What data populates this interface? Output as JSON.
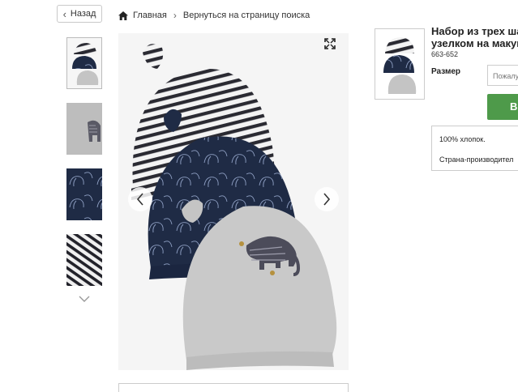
{
  "nav": {
    "back_label": "Назад"
  },
  "breadcrumb": {
    "home_label": "Главная",
    "search_label": "Вернуться на страницу поиска"
  },
  "product": {
    "title_line1": "Набор из трех шап",
    "title_line2": "узелком на макуш",
    "sku": "663-652",
    "size_label": "Размер",
    "size_placeholder": "Пожалу",
    "buy_label": "В",
    "composition": "100% хлопок.",
    "country": "Страна-производител"
  },
  "gallery": {
    "thumbnails": [
      "three-hats-set",
      "grey-elephant-hat-detail",
      "navy-elephant-print-detail",
      "striped-fabric-detail"
    ],
    "main_image": "three-knot-hats"
  },
  "icons": {
    "home": "home-icon",
    "back": "chevron-left-icon",
    "zoom": "expand-icon",
    "prev": "chevron-left-icon",
    "next": "chevron-right-icon",
    "more": "chevron-down-icon"
  },
  "colors": {
    "buy_button": "#4e9a4a",
    "navy": "#1f2b45",
    "grey_hat": "#c8c8c8",
    "stripe": "#2a2a32"
  }
}
